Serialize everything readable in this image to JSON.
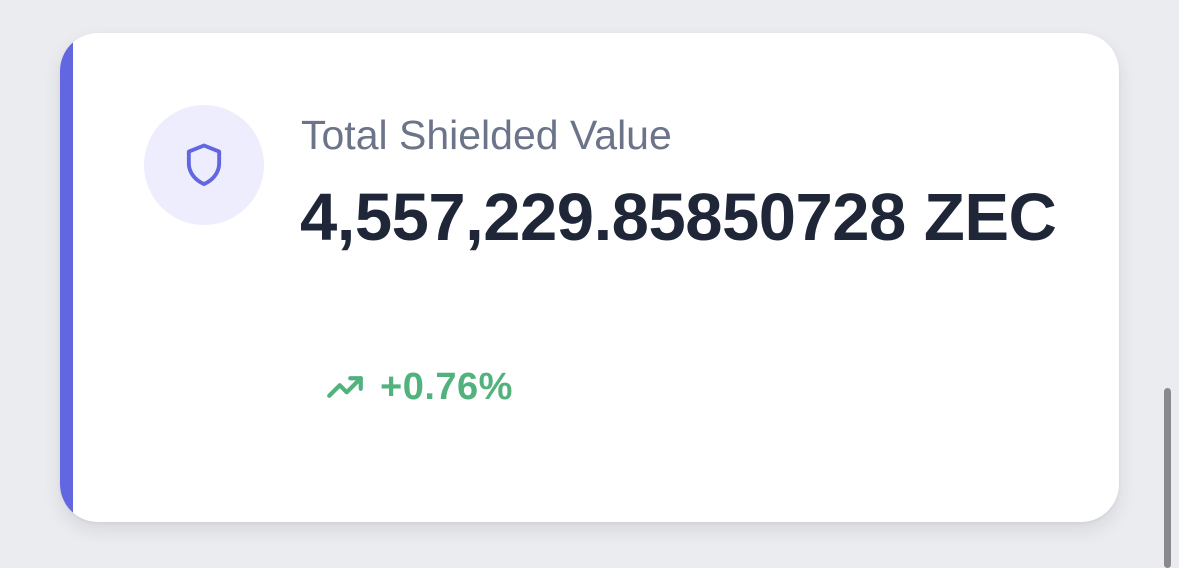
{
  "card": {
    "label": "Total Shielded Value",
    "value": "4,557,229.85850728 ZEC",
    "change": "+0.76%"
  },
  "icons": {
    "main": "shield-icon",
    "change": "trending-up-icon"
  },
  "colors": {
    "accent": "#6366e1",
    "icon_background": "#eeedfd",
    "label": "#6b7488",
    "value": "#1e2638",
    "positive_change": "#52b27e",
    "page_background": "#ebecf0"
  }
}
